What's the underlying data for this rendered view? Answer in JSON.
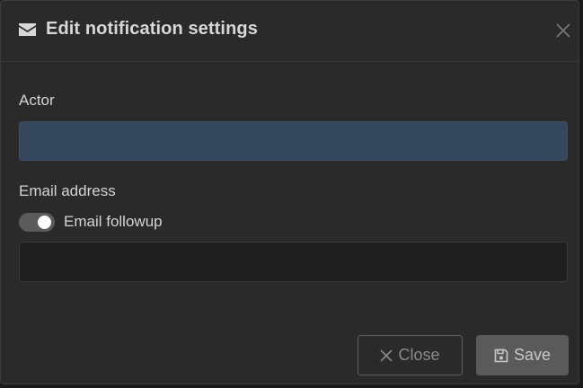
{
  "dialog": {
    "title": "Edit notification settings",
    "title_icon": "envelope-icon",
    "close_icon": "close-icon"
  },
  "form": {
    "actor": {
      "label": "Actor",
      "value": "",
      "placeholder": ""
    },
    "email": {
      "label": "Email address",
      "toggle_label": "Email followup",
      "toggle_on": true,
      "value": "",
      "placeholder": ""
    }
  },
  "footer": {
    "close_label": "Close",
    "close_icon": "times-icon",
    "save_label": "Save",
    "save_icon": "floppy-disk-icon"
  },
  "colors": {
    "dialog_bg": "#2a2a2a",
    "actor_input_bg": "#35475c",
    "email_input_bg": "#1e1e1e",
    "save_button_bg": "#5a5a5a"
  }
}
